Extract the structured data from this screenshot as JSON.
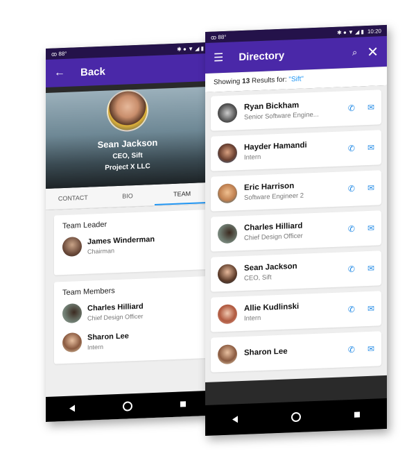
{
  "status_bar": {
    "left_temp": "88°",
    "time": "10:20"
  },
  "left_screen": {
    "appbar": {
      "back_label": "Back"
    },
    "profile": {
      "name": "Sean Jackson",
      "title": "CEO, Sift",
      "company": "Project X LLC"
    },
    "tabs": [
      {
        "label": "CONTACT",
        "active": false
      },
      {
        "label": "BIO",
        "active": false
      },
      {
        "label": "TEAM",
        "active": true
      }
    ],
    "team_leader": {
      "heading": "Team Leader",
      "person": {
        "name": "James Winderman",
        "role": "Chairman"
      }
    },
    "team_members": {
      "heading": "Team Members",
      "people": [
        {
          "name": "Charles Hilliard",
          "role": "Chief Design Officer"
        },
        {
          "name": "Sharon Lee",
          "role": "Intern"
        }
      ]
    }
  },
  "right_screen": {
    "appbar": {
      "title": "Directory"
    },
    "results": {
      "prefix": "Showing",
      "count": "13",
      "suffix": "Results  for:",
      "query": "\"Sift\""
    },
    "directory": [
      {
        "name": "Ryan Bickham",
        "role": "Senior Software Engine..."
      },
      {
        "name": "Hayder Hamandi",
        "role": "Intern"
      },
      {
        "name": "Eric Harrison",
        "role": "Software Engineer 2"
      },
      {
        "name": "Charles Hilliard",
        "role": "Chief Design Officer"
      },
      {
        "name": "Sean Jackson",
        "role": "CEO, Sift"
      },
      {
        "name": "Allie Kudlinski",
        "role": "Intern"
      },
      {
        "name": "Sharon Lee",
        "role": ""
      }
    ]
  },
  "colors": {
    "primary": "#4a28a8",
    "status": "#24124a",
    "accent": "#1e88e5"
  }
}
